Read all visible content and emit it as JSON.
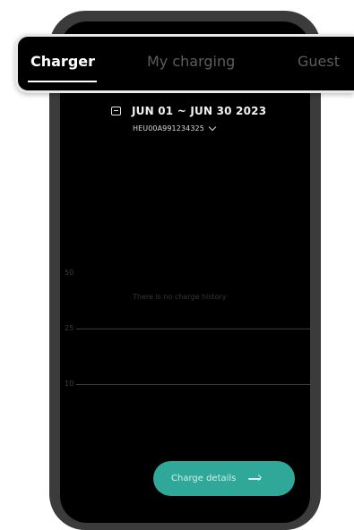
{
  "tabs": {
    "charger": "Charger",
    "my_charging": "My charging",
    "guest": "Guest",
    "active": "Charger"
  },
  "filter": {
    "date_range": "JUN 01 ~ JUN 30  2023",
    "calendar_icon": "calendar-icon",
    "charger_id": "HEU00A991234325",
    "dropdown_icon": "chevron-down-icon"
  },
  "chart": {
    "axis_labels": [
      "50",
      "25",
      "10"
    ],
    "empty_message": "There is no charge history"
  },
  "details_button": {
    "label": "Charge details",
    "icon": "arrow-right-icon",
    "color": "#2fa89a"
  },
  "colors": {
    "background": "#000000",
    "frame": "#3b3b3b",
    "accent": "#2fa89a"
  }
}
